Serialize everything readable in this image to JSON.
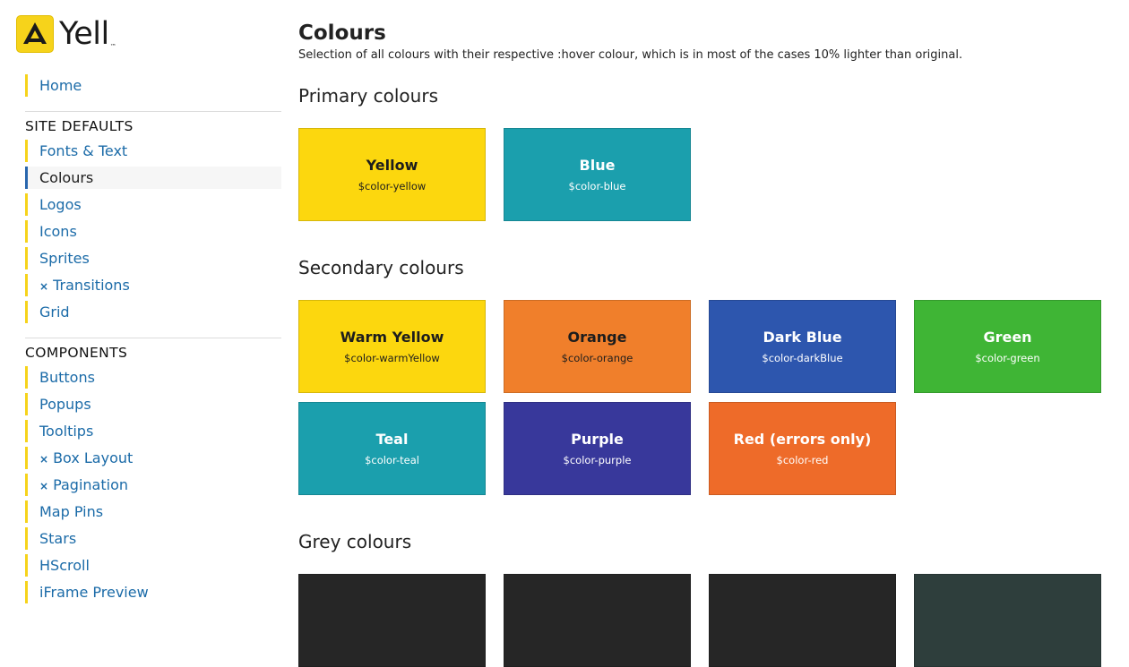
{
  "brand": {
    "logo_text": "Yell",
    "trademark": "™"
  },
  "sidebar": {
    "home_label": "Home",
    "site_defaults_heading": "SITE DEFAULTS",
    "site_defaults": [
      {
        "label": "Fonts & Text",
        "prefix": ""
      },
      {
        "label": "Colours",
        "prefix": "",
        "active": true
      },
      {
        "label": "Logos",
        "prefix": ""
      },
      {
        "label": "Icons",
        "prefix": ""
      },
      {
        "label": "Sprites",
        "prefix": ""
      },
      {
        "label": "Transitions",
        "prefix": "×"
      },
      {
        "label": "Grid",
        "prefix": ""
      }
    ],
    "components_heading": "COMPONENTS",
    "components": [
      {
        "label": "Buttons",
        "prefix": ""
      },
      {
        "label": "Popups",
        "prefix": ""
      },
      {
        "label": "Tooltips",
        "prefix": ""
      },
      {
        "label": "Box Layout",
        "prefix": "×"
      },
      {
        "label": "Pagination",
        "prefix": "×"
      },
      {
        "label": "Map Pins",
        "prefix": ""
      },
      {
        "label": "Stars",
        "prefix": ""
      },
      {
        "label": "HScroll",
        "prefix": ""
      },
      {
        "label": "iFrame Preview",
        "prefix": ""
      }
    ]
  },
  "main": {
    "title": "Colours",
    "description": "Selection of all colours with their respective :hover colour, which is in most of the cases 10% lighter than original.",
    "primary_heading": "Primary colours",
    "secondary_heading": "Secondary colours",
    "grey_heading": "Grey colours",
    "primary": [
      {
        "name": "Yellow",
        "var": "$color-yellow",
        "bg": "#fcd70e",
        "fg": "#1d1d1d"
      },
      {
        "name": "Blue",
        "var": "$color-blue",
        "bg": "#1b9fad",
        "fg": "#ffffff"
      }
    ],
    "secondary": [
      {
        "name": "Warm Yellow",
        "var": "$color-warmYellow",
        "bg": "#fcd70e",
        "fg": "#1d1d1d"
      },
      {
        "name": "Orange",
        "var": "$color-orange",
        "bg": "#f07f2b",
        "fg": "#1d1d1d"
      },
      {
        "name": "Dark Blue",
        "var": "$color-darkBlue",
        "bg": "#2d56ae",
        "fg": "#ffffff"
      },
      {
        "name": "Green",
        "var": "$color-green",
        "bg": "#3fb535",
        "fg": "#ffffff"
      },
      {
        "name": "Teal",
        "var": "$color-teal",
        "bg": "#1b9fad",
        "fg": "#ffffff"
      },
      {
        "name": "Purple",
        "var": "$color-purple",
        "bg": "#38389b",
        "fg": "#ffffff"
      },
      {
        "name": "Red (errors only)",
        "var": "$color-red",
        "bg": "#ee6b29",
        "fg": "#ffffff"
      }
    ],
    "grey": [
      {
        "bg": "#262626"
      },
      {
        "bg": "#262626"
      },
      {
        "bg": "#262626"
      },
      {
        "bg": "#2e3e3c"
      }
    ]
  }
}
